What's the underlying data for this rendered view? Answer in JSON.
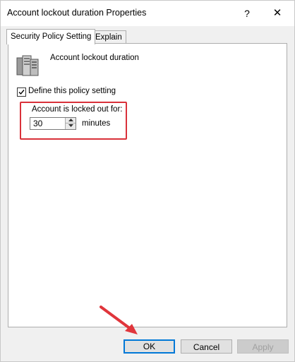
{
  "window": {
    "title": "Account lockout duration Properties",
    "help_glyph": "?",
    "close_glyph": "✕"
  },
  "tabs": [
    {
      "label": "Security Policy Setting",
      "active": true
    },
    {
      "label": "Explain",
      "active": false
    }
  ],
  "policy": {
    "name": "Account lockout duration",
    "icon": "server-policy-icon"
  },
  "define_setting": {
    "label": "Define this policy setting",
    "checked": true
  },
  "lockout": {
    "group_label": "Account is locked out for:",
    "value": "30",
    "unit": "minutes"
  },
  "buttons": {
    "ok": "OK",
    "cancel": "Cancel",
    "apply": "Apply"
  },
  "colors": {
    "highlight": "#d9313a",
    "default_button_border": "#0078d7"
  }
}
